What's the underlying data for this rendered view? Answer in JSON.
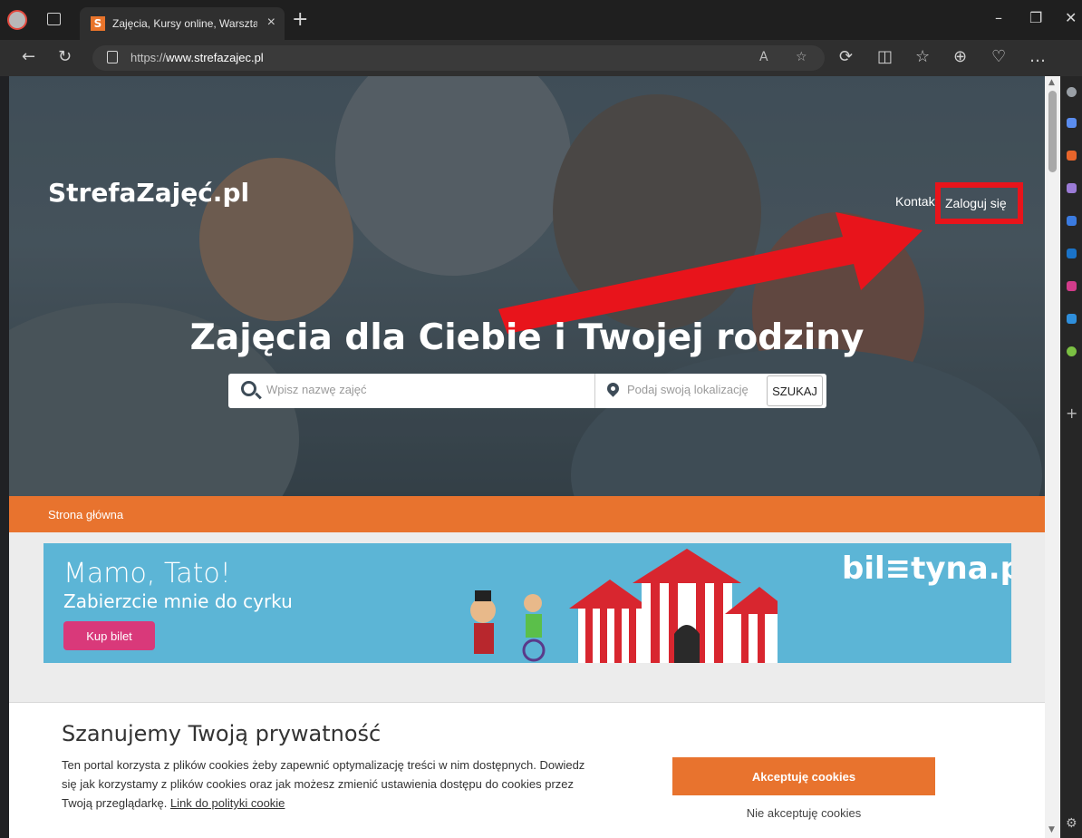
{
  "browser": {
    "tab_title": "Zajęcia, Kursy online, Warsztaty, |",
    "tab_favicon": "S",
    "url_prefix": "https://",
    "url_host": "www.strefazajec.pl"
  },
  "header": {
    "logo": "StrefaZajęć.pl",
    "nav_contact": "Kontakt",
    "nav_login": "Zaloguj się"
  },
  "hero": {
    "title": "Zajęcia dla Ciebie i Twojej rodziny",
    "search_placeholder": "Wpisz nazwę zajęć",
    "location_placeholder": "Podaj swoją lokalizację",
    "search_button": "SZUKAJ"
  },
  "breadcrumb": {
    "home": "Strona główna"
  },
  "banner": {
    "line1": "Mamo, Tato!",
    "line2": "Zabierzcie mnie do cyrku",
    "button": "Kup bilet",
    "brand": "bil≡tyna.pl"
  },
  "cookie": {
    "title": "Szanujemy Twoją prywatność",
    "text": "Ten portal korzysta z plików cookies żeby zapewnić optymalizację treści w nim dostępnych. Dowiedz się jak korzystamy z plików cookies oraz jak możesz zmienić ustawienia dostępu do cookies przez Twoją przeglądarkę. ",
    "link": "Link do polityki cookie",
    "accept": "Akceptuję cookies",
    "reject": "Nie akceptuję cookies"
  },
  "colors": {
    "accent_orange": "#e8732e",
    "highlight_red": "#e8141b",
    "banner_blue": "#5cb5d6",
    "banner_pink": "#d9397a"
  }
}
